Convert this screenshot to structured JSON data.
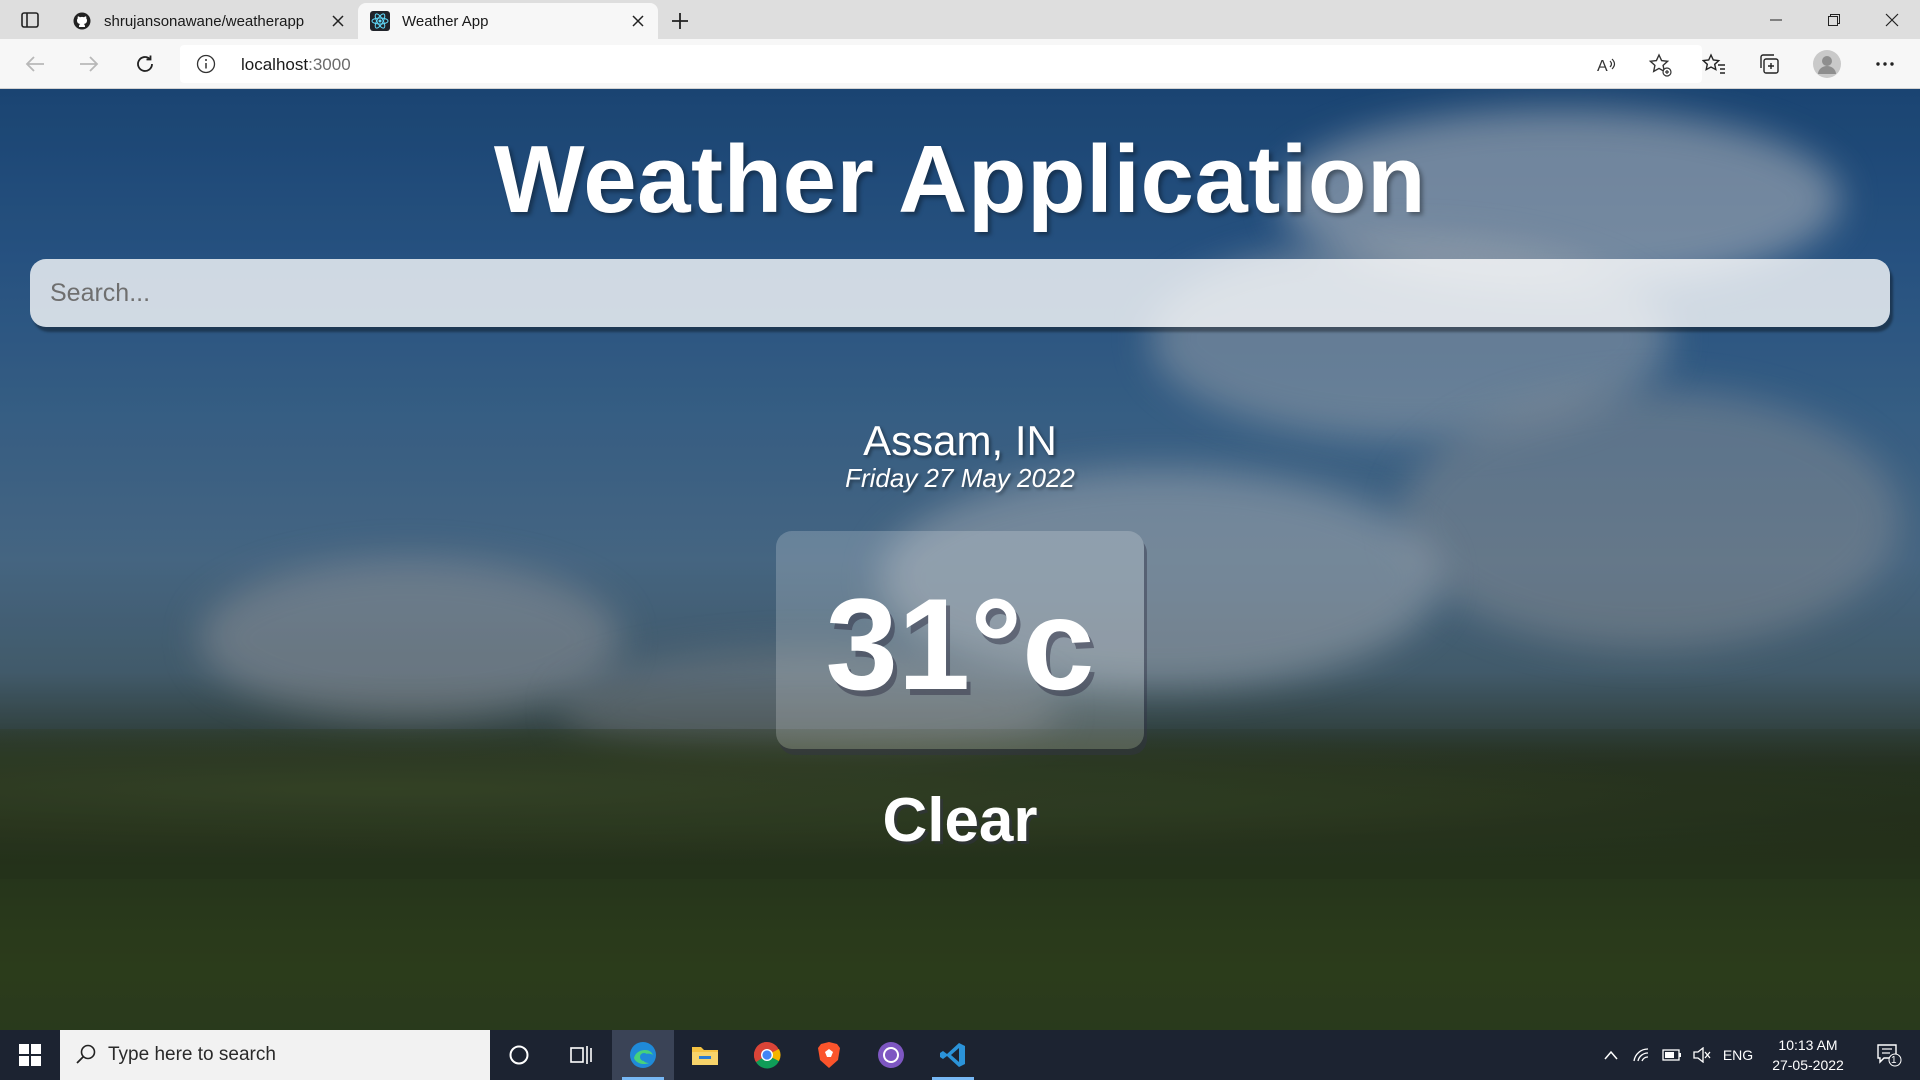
{
  "browser": {
    "tabs": [
      {
        "title": "shrujansonawane/weatherapp",
        "favicon": "github-icon",
        "active": false
      },
      {
        "title": "Weather App",
        "favicon": "react-icon",
        "active": true
      }
    ],
    "url": {
      "host": "localhost",
      "port": ":3000"
    }
  },
  "app": {
    "title": "Weather Application",
    "search_placeholder": "Search...",
    "location": "Assam, IN",
    "date": "Friday 27 May 2022",
    "temperature": "31°c",
    "condition": "Clear"
  },
  "taskbar": {
    "search_placeholder": "Type here to search",
    "language": "ENG",
    "time": "10:13 AM",
    "date": "27-05-2022",
    "notification_count": "1"
  },
  "colors": {
    "accent": "#77b8f5",
    "taskbar": "#1c2331"
  }
}
